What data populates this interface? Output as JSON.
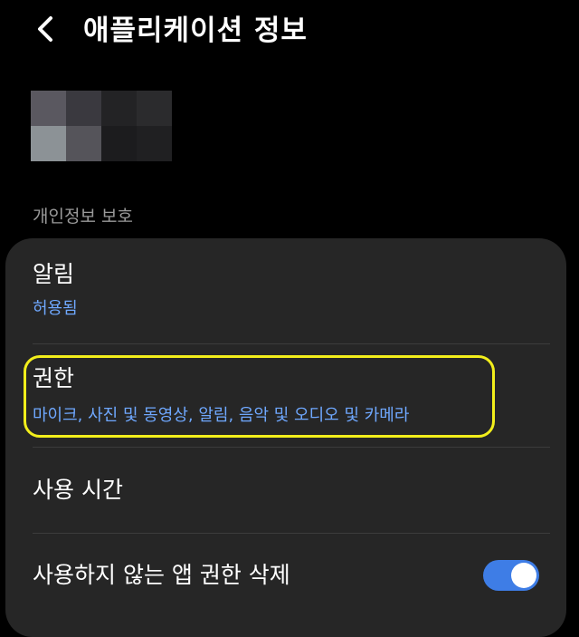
{
  "header": {
    "title": "애플리케이션 정보",
    "back_icon": "chevron-left-icon"
  },
  "app_icon": {
    "pixels": [
      "#5a5860",
      "#3a393f",
      "#232325",
      "#2b2b2d",
      "#8c9296",
      "#55545a",
      "#1c1c1e",
      "#202022"
    ]
  },
  "section": {
    "label": "개인정보 보호"
  },
  "items": [
    {
      "title": "알림",
      "subtitle": "허용됨"
    },
    {
      "title": "권한",
      "subtitle": "마이크, 사진 및 동영상, 알림, 음악 및 오디오 및 카메라"
    },
    {
      "title": "사용 시간"
    },
    {
      "title": "사용하지 않는 앱 권한 삭제",
      "toggle_on": true
    }
  ],
  "colors": {
    "accent": "#3e7de6",
    "subtitle": "#6fa8ff",
    "highlight": "#f2ee1b",
    "card": "#262626"
  }
}
